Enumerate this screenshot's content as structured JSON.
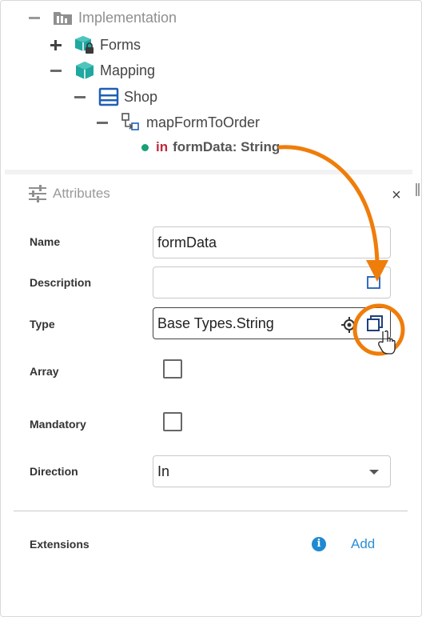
{
  "tree": {
    "implementation": {
      "label": "Implementation",
      "icon": "folder-icon"
    },
    "forms": {
      "label": "Forms",
      "icon": "locked-package-icon"
    },
    "mapping": {
      "label": "Mapping",
      "icon": "package-icon"
    },
    "shop": {
      "label": "Shop",
      "icon": "class-icon"
    },
    "operation": {
      "label": "mapFormToOrder",
      "icon": "operation-icon"
    },
    "parameter": {
      "direction": "in",
      "label": "formData: String"
    }
  },
  "attributes": {
    "title": "Attributes",
    "close": "×",
    "fields": {
      "name": {
        "label": "Name",
        "value": "formData"
      },
      "description": {
        "label": "Description",
        "value": ""
      },
      "type": {
        "label": "Type",
        "value": "Base Types.String"
      },
      "array": {
        "label": "Array",
        "checked": false
      },
      "mandatory": {
        "label": "Mandatory",
        "checked": false
      },
      "direction": {
        "label": "Direction",
        "value": "In"
      }
    },
    "extensions": {
      "label": "Extensions",
      "info": "i",
      "add_label": "Add"
    }
  },
  "colors": {
    "accent": "#2d8fd5",
    "teal": "#1fa7a0",
    "highlight_orange": "#ef7d0a",
    "in_keyword": "#c0283a",
    "status_dot": "#19a078"
  }
}
